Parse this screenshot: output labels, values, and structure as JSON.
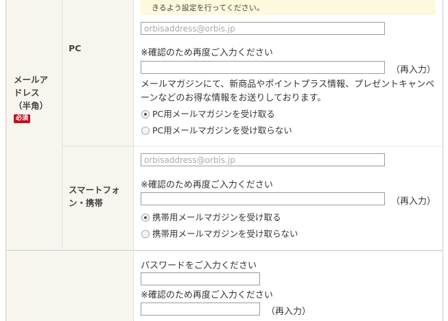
{
  "notice": {
    "text": "きるよう設定を行ってください。"
  },
  "email_section": {
    "label": "メールアドレス（半角）",
    "label_lines": [
      "メールア",
      "ドレス",
      "（半角）"
    ],
    "required_badge": "必須",
    "pc": {
      "label": "PC",
      "placeholder": "orbisaddress@orbis.jp",
      "confirm_hint": "※確認のため再度ご入力ください",
      "reenter_label": "（再入力）",
      "newsletter_note": "メールマガジンにて、新商品やポイントプラス情報、プレゼントキャンペーンなどのお得な情報をお送りしております。",
      "options": [
        {
          "label": "PC用メールマガジンを受け取る",
          "selected": true
        },
        {
          "label": "PC用メールマガジンを受け取らない",
          "selected": false
        }
      ]
    },
    "mobile": {
      "label": "スマートフォン・携帯",
      "label_lines": [
        "スマートフォ",
        "ン・携帯"
      ],
      "placeholder": "orbisaddress@orbis.jp",
      "confirm_hint": "※確認のため再度ご入力ください",
      "reenter_label": "（再入力）",
      "options": [
        {
          "label": "携帯用メールマガジンを受け取る",
          "selected": true
        },
        {
          "label": "携帯用メールマガジンを受け取らない",
          "selected": false
        }
      ]
    }
  },
  "password_section": {
    "prompt": "パスワードをご入力ください",
    "confirm_hint": "※確認のため再度ご入力ください",
    "reenter_label": "（再入力）"
  }
}
